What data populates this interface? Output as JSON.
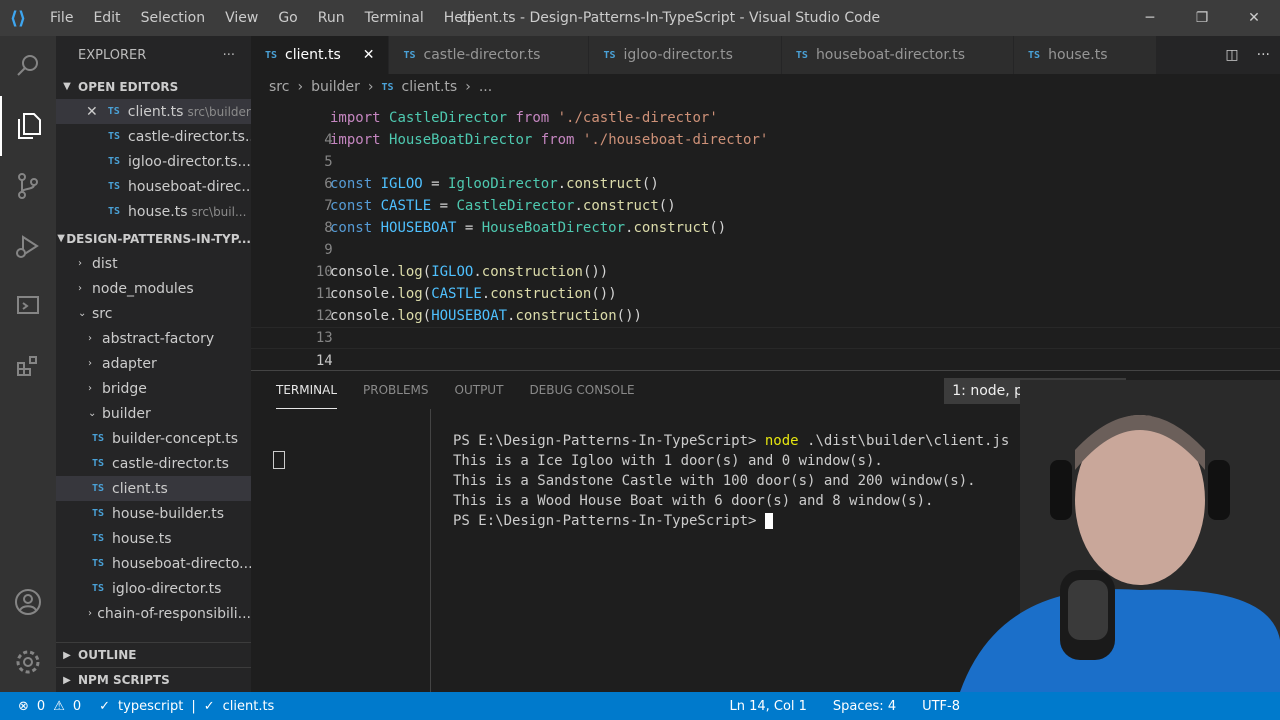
{
  "titlebar": {
    "menu": [
      "File",
      "Edit",
      "Selection",
      "View",
      "Go",
      "Run",
      "Terminal",
      "Help"
    ],
    "title": "client.ts - Design-Patterns-In-TypeScript - Visual Studio Code"
  },
  "sidebar": {
    "header": "EXPLORER",
    "open_editors_label": "OPEN EDITORS",
    "open_editors": [
      {
        "name": "client.ts",
        "desc": "src\\builder"
      },
      {
        "name": "castle-director.ts...",
        "desc": ""
      },
      {
        "name": "igloo-director.ts...",
        "desc": ""
      },
      {
        "name": "houseboat-direc...",
        "desc": ""
      },
      {
        "name": "house.ts",
        "desc": "src\\buil..."
      }
    ],
    "project_label": "DESIGN-PATTERNS-IN-TYP...",
    "tree": {
      "dist": "dist",
      "node_modules": "node_modules",
      "src": "src",
      "abstract_factory": "abstract-factory",
      "adapter": "adapter",
      "bridge": "bridge",
      "builder": "builder",
      "files": [
        "builder-concept.ts",
        "castle-director.ts",
        "client.ts",
        "house-builder.ts",
        "house.ts",
        "houseboat-directo...",
        "igloo-director.ts"
      ],
      "chain": "chain-of-responsibili..."
    },
    "outline_label": "OUTLINE",
    "npm_label": "NPM SCRIPTS"
  },
  "tabs": [
    "client.ts",
    "castle-director.ts",
    "igloo-director.ts",
    "houseboat-director.ts",
    "house.ts"
  ],
  "breadcrumb": [
    "src",
    "builder",
    "client.ts",
    "..."
  ],
  "editor": {
    "line_numbers": [
      "4",
      "5",
      "6",
      "7",
      "8",
      "9",
      "10",
      "11",
      "12",
      "13",
      "14"
    ],
    "lines": {
      "l4_class": "CastleDirector",
      "l4_str": "'./castle-director'",
      "l5_class": "HouseBoatDirector",
      "l5_str": "'./houseboat-director'",
      "kw_import": "import",
      "kw_from": "from",
      "kw_const": "const",
      "v_igloo": "IGLOO",
      "v_castle": "CASTLE",
      "v_houseboat": "HOUSEBOAT",
      "c_igloo": "IglooDirector",
      "c_castle": "CastleDirector",
      "c_houseboat": "HouseBoatDirector",
      "construct": "construct",
      "construction": "construction",
      "console": "console",
      "log": "log"
    }
  },
  "panel": {
    "tabs": [
      "TERMINAL",
      "PROBLEMS",
      "OUTPUT",
      "DEBUG CONSOLE"
    ],
    "select": "1: node, powershell",
    "terminal": {
      "prompt": "PS E:\\Design-Patterns-In-TypeScript>",
      "command_node": "node",
      "command_args": " .\\dist\\builder\\client.js",
      "out1": "This is a Ice Igloo with 1 door(s) and 0 window(s).",
      "out2": "This is a Sandstone Castle with 100 door(s) and 200 window(s).",
      "out3": "This is a Wood House Boat with 6 door(s) and 8 window(s)."
    }
  },
  "status": {
    "errors": "0",
    "warnings": "0",
    "lang": "typescript",
    "file": "client.ts",
    "position": "Ln 14, Col 1",
    "spaces": "Spaces: 4",
    "encoding": "UTF-8"
  }
}
